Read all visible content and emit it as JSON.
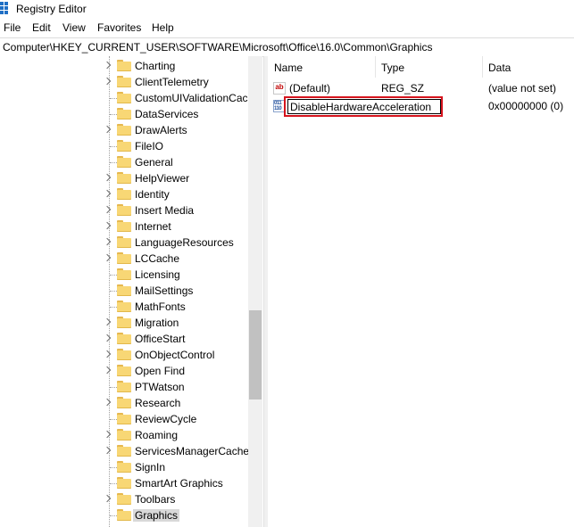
{
  "window": {
    "title": "Registry Editor"
  },
  "menu": [
    "File",
    "Edit",
    "View",
    "Favorites",
    "Help"
  ],
  "address": "Computer\\HKEY_CURRENT_USER\\SOFTWARE\\Microsoft\\Office\\16.0\\Common\\Graphics",
  "tree": {
    "items": [
      {
        "label": "Charting",
        "expandable": true
      },
      {
        "label": "ClientTelemetry",
        "expandable": true
      },
      {
        "label": "CustomUIValidationCac",
        "expandable": false
      },
      {
        "label": "DataServices",
        "expandable": false
      },
      {
        "label": "DrawAlerts",
        "expandable": true
      },
      {
        "label": "FileIO",
        "expandable": false
      },
      {
        "label": "General",
        "expandable": false
      },
      {
        "label": "HelpViewer",
        "expandable": true
      },
      {
        "label": "Identity",
        "expandable": true
      },
      {
        "label": "Insert Media",
        "expandable": true
      },
      {
        "label": "Internet",
        "expandable": true
      },
      {
        "label": "LanguageResources",
        "expandable": true
      },
      {
        "label": "LCCache",
        "expandable": true
      },
      {
        "label": "Licensing",
        "expandable": false
      },
      {
        "label": "MailSettings",
        "expandable": false
      },
      {
        "label": "MathFonts",
        "expandable": false
      },
      {
        "label": "Migration",
        "expandable": true
      },
      {
        "label": "OfficeStart",
        "expandable": true
      },
      {
        "label": "OnObjectControl",
        "expandable": true
      },
      {
        "label": "Open Find",
        "expandable": true
      },
      {
        "label": "PTWatson",
        "expandable": false
      },
      {
        "label": "Research",
        "expandable": true
      },
      {
        "label": "ReviewCycle",
        "expandable": false
      },
      {
        "label": "Roaming",
        "expandable": true
      },
      {
        "label": "ServicesManagerCache",
        "expandable": true
      },
      {
        "label": "SignIn",
        "expandable": false
      },
      {
        "label": "SmartArt Graphics",
        "expandable": false
      },
      {
        "label": "Toolbars",
        "expandable": true
      },
      {
        "label": "Graphics",
        "expandable": false,
        "selected": true
      }
    ]
  },
  "list": {
    "columns": {
      "name": "Name",
      "type": "Type",
      "data": "Data"
    },
    "rows": [
      {
        "icon": "string-value-icon",
        "icon_text": "ab",
        "name": "(Default)",
        "type": "REG_SZ",
        "data": "(value not set)"
      },
      {
        "icon": "binary-value-icon",
        "icon_text": "011 110",
        "rename_value": "DisableHardwareAcceleration",
        "type": "",
        "data": "0x00000000 (0)"
      }
    ]
  },
  "colors": {
    "highlight": "#d6141d",
    "folder": "#f8d775"
  }
}
